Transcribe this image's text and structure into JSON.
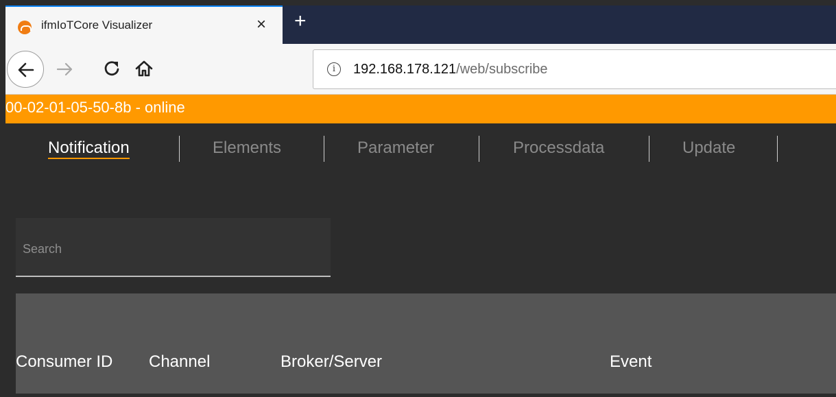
{
  "browser": {
    "tab_title": "ifmIoTCore Visualizer",
    "tab_close": "×",
    "new_tab": "+",
    "url_host": "192.168.178.121",
    "url_path": "/web/subscribe",
    "info_glyph": "i",
    "icons": [
      "back-arrow-icon",
      "forward-arrow-icon",
      "reload-icon",
      "home-icon",
      "info-icon"
    ]
  },
  "status": {
    "text": "00-02-01-05-50-8b - online",
    "color": "#ff9900"
  },
  "nav": {
    "items": [
      {
        "label": "Notification",
        "active": true
      },
      {
        "label": "Elements",
        "active": false
      },
      {
        "label": "Parameter",
        "active": false
      },
      {
        "label": "Processdata",
        "active": false
      },
      {
        "label": "Update",
        "active": false
      }
    ]
  },
  "search": {
    "placeholder": "Search",
    "value": ""
  },
  "table": {
    "columns": [
      "Consumer ID",
      "Channel",
      "Broker/Server",
      "Event"
    ],
    "rows": []
  }
}
